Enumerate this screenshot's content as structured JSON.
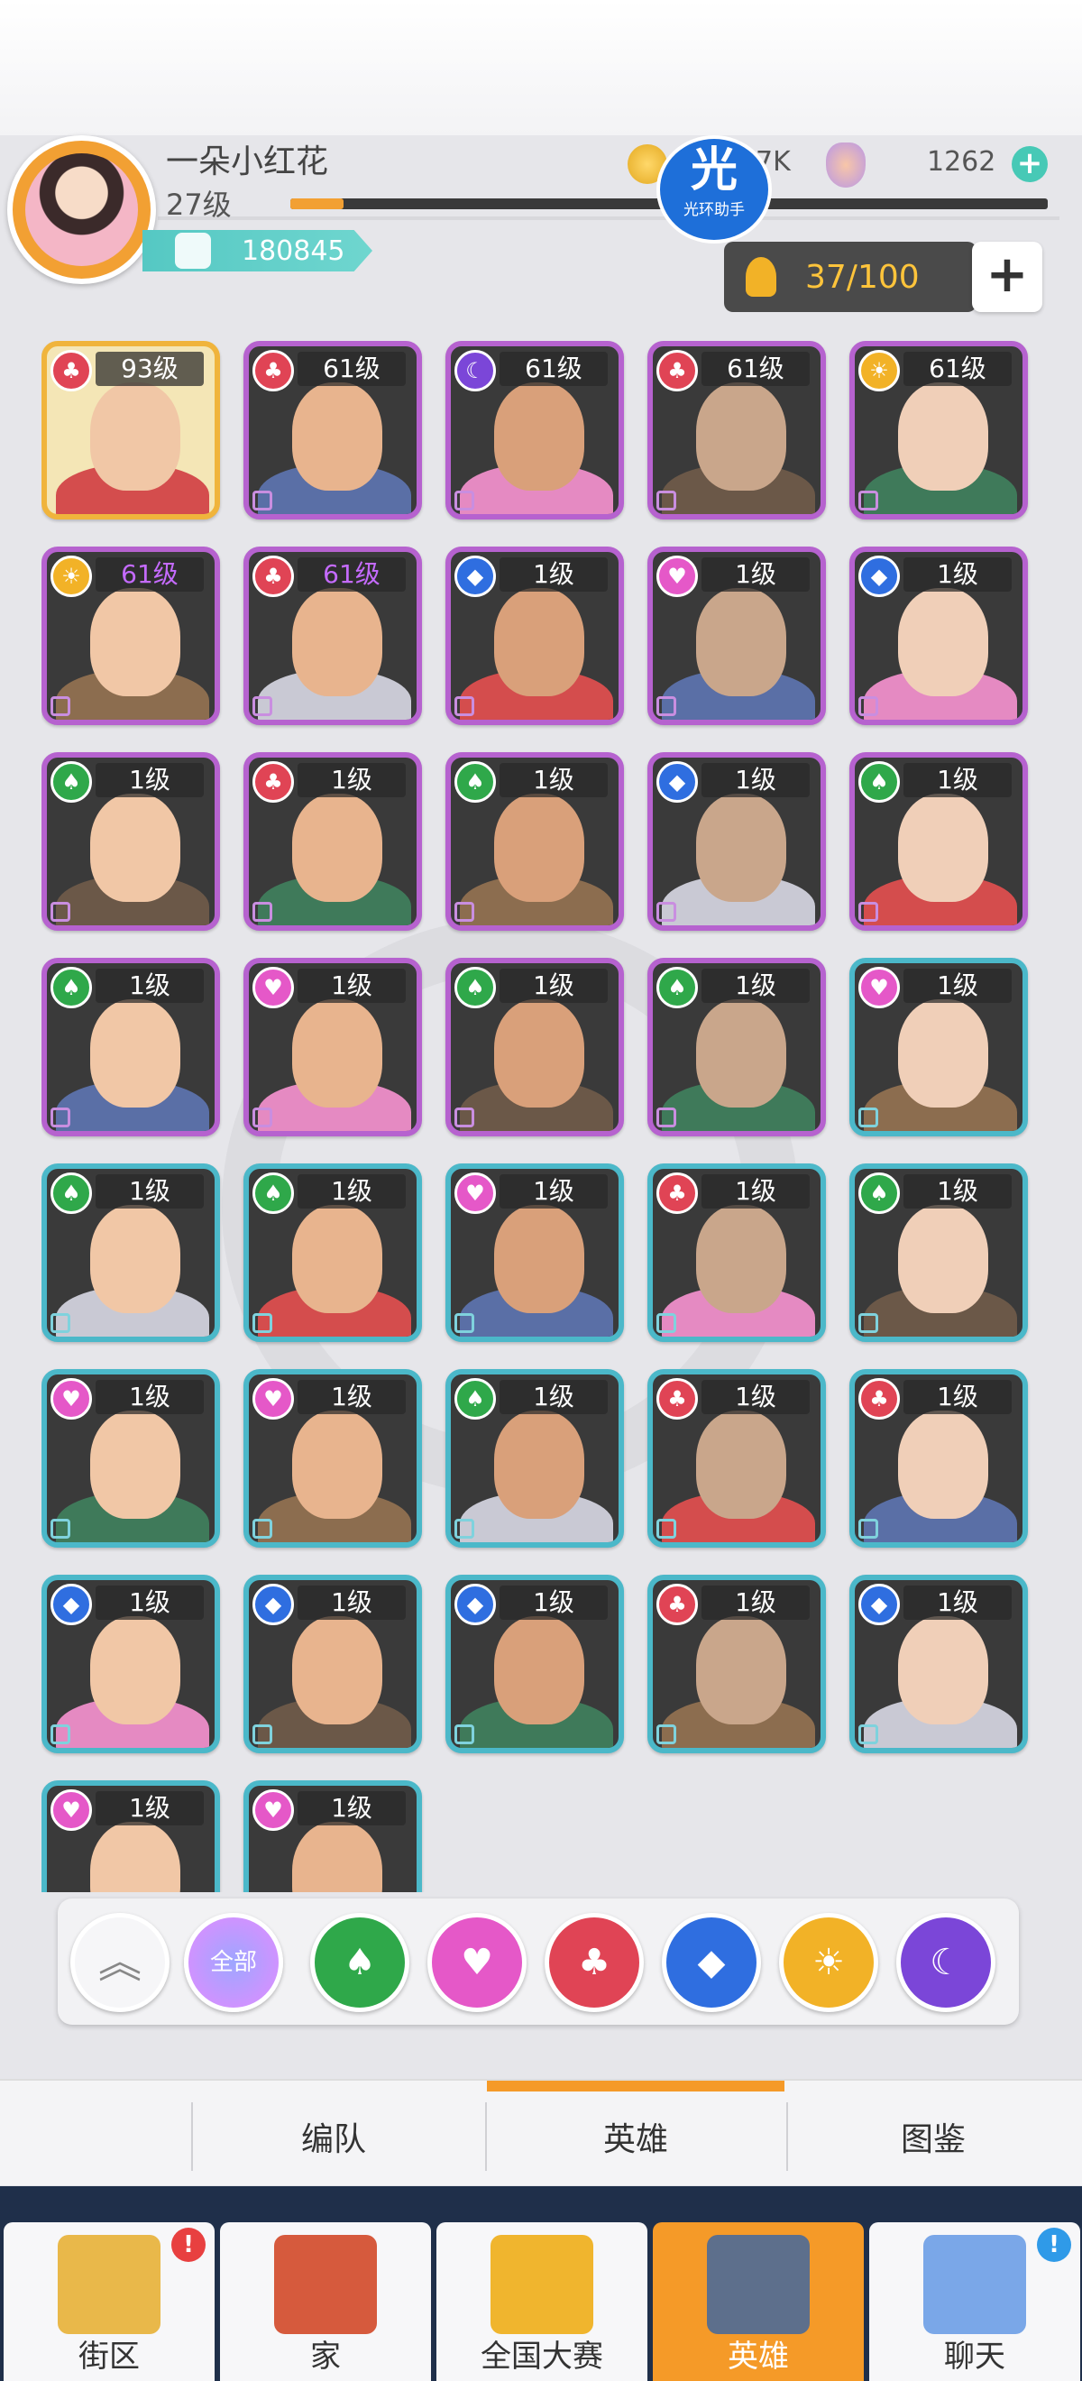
{
  "player": {
    "name": "一朵小红花",
    "level": "27级",
    "power": "180845",
    "exp_fraction": 0.07
  },
  "resources": {
    "coins": "7K",
    "gems": "1262"
  },
  "watermark": {
    "big": "光",
    "small": "光环助手"
  },
  "capacity": "37/100",
  "heroes": [
    {
      "level": "93级",
      "suit": "red",
      "frame": "gold"
    },
    {
      "level": "61级",
      "suit": "red",
      "frame": "purple"
    },
    {
      "level": "61级",
      "suit": "moon",
      "frame": "purple"
    },
    {
      "level": "61级",
      "suit": "red",
      "frame": "purple"
    },
    {
      "level": "61级",
      "suit": "gold",
      "frame": "purple"
    },
    {
      "level": "61级",
      "suit": "gold",
      "frame": "purple",
      "purple_text": true
    },
    {
      "level": "61级",
      "suit": "red",
      "frame": "purple",
      "purple_text": true
    },
    {
      "level": "1级",
      "suit": "blue",
      "frame": "purple"
    },
    {
      "level": "1级",
      "suit": "pink",
      "frame": "purple"
    },
    {
      "level": "1级",
      "suit": "blue",
      "frame": "purple"
    },
    {
      "level": "1级",
      "suit": "green",
      "frame": "purple"
    },
    {
      "level": "1级",
      "suit": "red",
      "frame": "purple"
    },
    {
      "level": "1级",
      "suit": "green",
      "frame": "purple"
    },
    {
      "level": "1级",
      "suit": "blue",
      "frame": "purple"
    },
    {
      "level": "1级",
      "suit": "green",
      "frame": "purple"
    },
    {
      "level": "1级",
      "suit": "green",
      "frame": "purple"
    },
    {
      "level": "1级",
      "suit": "pink",
      "frame": "purple"
    },
    {
      "level": "1级",
      "suit": "green",
      "frame": "purple"
    },
    {
      "level": "1级",
      "suit": "green",
      "frame": "purple"
    },
    {
      "level": "1级",
      "suit": "pink",
      "frame": "cyan"
    },
    {
      "level": "1级",
      "suit": "green",
      "frame": "cyan"
    },
    {
      "level": "1级",
      "suit": "green",
      "frame": "cyan"
    },
    {
      "level": "1级",
      "suit": "pink",
      "frame": "cyan"
    },
    {
      "level": "1级",
      "suit": "red",
      "frame": "cyan"
    },
    {
      "level": "1级",
      "suit": "green",
      "frame": "cyan"
    },
    {
      "level": "1级",
      "suit": "pink",
      "frame": "cyan"
    },
    {
      "level": "1级",
      "suit": "pink",
      "frame": "cyan"
    },
    {
      "level": "1级",
      "suit": "green",
      "frame": "cyan"
    },
    {
      "level": "1级",
      "suit": "red",
      "frame": "cyan"
    },
    {
      "level": "1级",
      "suit": "red",
      "frame": "cyan"
    },
    {
      "level": "1级",
      "suit": "blue",
      "frame": "cyan"
    },
    {
      "level": "1级",
      "suit": "blue",
      "frame": "cyan"
    },
    {
      "level": "1级",
      "suit": "blue",
      "frame": "cyan"
    },
    {
      "level": "1级",
      "suit": "red",
      "frame": "cyan"
    },
    {
      "level": "1级",
      "suit": "blue",
      "frame": "cyan"
    },
    {
      "level": "1级",
      "suit": "pink",
      "frame": "cyan"
    },
    {
      "level": "1级",
      "suit": "pink",
      "frame": "cyan"
    }
  ],
  "filters": {
    "collapse_icon": "double-chevron-up-icon",
    "all_label": "全部",
    "suits": [
      "spade-green",
      "heart-pink",
      "club-red",
      "diamond-blue",
      "sun-gold",
      "moon-purple"
    ],
    "colors": {
      "green": "#2fa84a",
      "pink": "#e558c8",
      "red": "#e04455",
      "blue": "#2f6ee0",
      "gold": "#f2b227",
      "moon": "#7b46d8"
    }
  },
  "tabs": [
    {
      "label": "编队",
      "active": false
    },
    {
      "label": "英雄",
      "active": true
    },
    {
      "label": "图鉴",
      "active": false
    }
  ],
  "nav": [
    {
      "label": "街区",
      "icon": "signpost-icon",
      "badge": "!",
      "active": false
    },
    {
      "label": "家",
      "icon": "house-icon",
      "badge": "",
      "active": false
    },
    {
      "label": "全国大赛",
      "icon": "trophy-icon",
      "badge": "",
      "active": false
    },
    {
      "label": "英雄",
      "icon": "cards-icon",
      "badge": "",
      "active": true
    },
    {
      "label": "聊天",
      "icon": "chat-bubbles-icon",
      "badge": "!",
      "active": false
    }
  ],
  "accent_color": "#f59a28"
}
